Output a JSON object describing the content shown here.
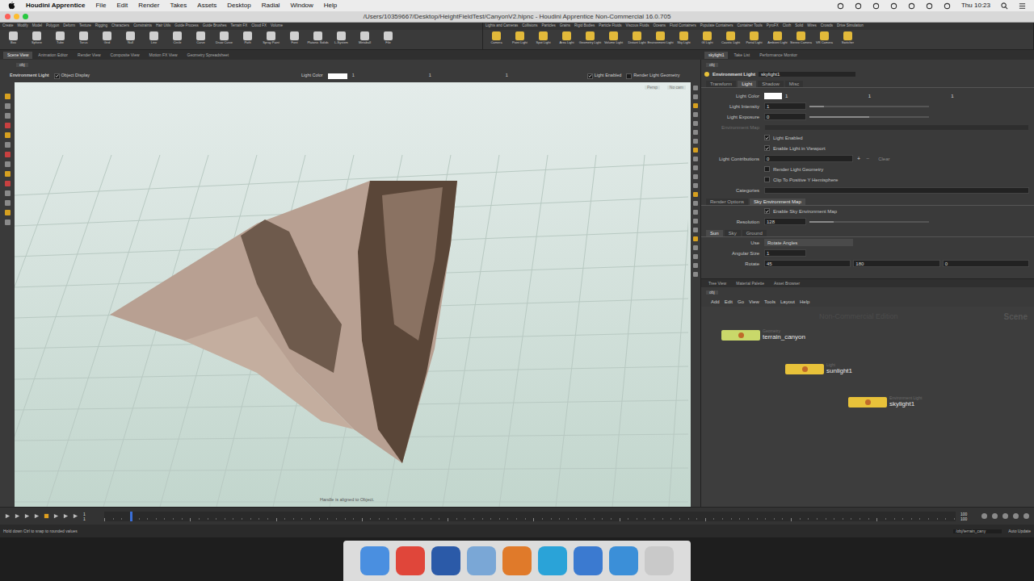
{
  "menubar": {
    "app": "Houdini Apprentice",
    "items": [
      "File",
      "Edit",
      "Render",
      "Takes",
      "Assets",
      "Desktop",
      "Radial",
      "Window",
      "Help"
    ],
    "clock": "Thu 10:23"
  },
  "window": {
    "title": "/Users/10359667/Desktop/HeightFieldTest/CanyonV2.hipnc - Houdini Apprentice Non-Commercial 16.0.705"
  },
  "shelf": {
    "left": {
      "tabs": [
        "Create",
        "Modify",
        "Model",
        "Polygon",
        "Deform",
        "Texture",
        "Rigging",
        "Characters",
        "Constraints",
        "Hair Utils",
        "Guide Process",
        "Guide Brushes",
        "Terrain FX",
        "Cloud FX",
        "Volume"
      ],
      "tools": [
        "Box",
        "Sphere",
        "Tube",
        "Torus",
        "Grid",
        "Null",
        "Line",
        "Circle",
        "Curve",
        "Draw Curve",
        "Path",
        "Spray Paint",
        "Font",
        "Platonic Solids",
        "L-System",
        "Metaball",
        "File"
      ]
    },
    "right": {
      "tabs": [
        "Lights and Cameras",
        "Collisions",
        "Particles",
        "Grains",
        "Rigid Bodies",
        "Particle Fluids",
        "Viscous Fluids",
        "Oceans",
        "Fluid Containers",
        "Populate Containers",
        "Container Tools",
        "PyroFX",
        "Cloth",
        "Solid",
        "Wires",
        "Crowds",
        "Drive Simulation"
      ],
      "tools": [
        "Camera",
        "Point Light",
        "Spot Light",
        "Area Light",
        "Geometry Light",
        "Volume Light",
        "Distant Light",
        "Environment Light",
        "Sky Light",
        "GI Light",
        "Caustic Light",
        "Portal Light",
        "Ambient Light",
        "Stereo Camera",
        "VR Camera",
        "Switcher"
      ]
    }
  },
  "left_pane_tabs": [
    {
      "label": "Scene View",
      "selected": true
    },
    {
      "label": "Animation Editor",
      "selected": false
    },
    {
      "label": "Render View",
      "selected": false
    },
    {
      "label": "Composite View",
      "selected": false
    },
    {
      "label": "Motion FX View",
      "selected": false
    },
    {
      "label": "Geometry Spreadsheet",
      "selected": false
    }
  ],
  "right_pane_tabs": [
    {
      "label": "skylight1",
      "selected": true
    },
    {
      "label": "Take List",
      "selected": false
    },
    {
      "label": "Performance Monitor",
      "selected": false
    }
  ],
  "viewport": {
    "path": "obj",
    "toolbar": {
      "node_type": "Environment Light",
      "object_display": {
        "label": "Object Display",
        "checked": true
      },
      "light_color": {
        "label": "Light Color",
        "values": [
          "1",
          "1",
          "1"
        ]
      },
      "light_enabled": {
        "label": "Light Enabled",
        "checked": true
      },
      "render_light_geometry": {
        "label": "Render Light Geometry",
        "checked": false
      }
    },
    "camera": "Persp",
    "cam": "No cam",
    "hint": "Handle is aligned to Object."
  },
  "params": {
    "path": "obj",
    "node_type": "Environment Light",
    "node_name": "skylight1",
    "tabs": [
      {
        "label": "Transform",
        "selected": false
      },
      {
        "label": "Light",
        "selected": true
      },
      {
        "label": "Shadow",
        "selected": false
      },
      {
        "label": "Misc",
        "selected": false
      }
    ],
    "rows": [
      {
        "kind": "color",
        "label": "Light Color",
        "values": [
          "1",
          "1",
          "1"
        ]
      },
      {
        "kind": "slider",
        "label": "Light Intensity",
        "value": "1",
        "level": 0.12
      },
      {
        "kind": "slider",
        "label": "Light Exposure",
        "value": "0",
        "level": 0.5
      },
      {
        "kind": "field",
        "label": "Environment Map",
        "disabled": true
      },
      {
        "kind": "check",
        "label": "Light Enabled",
        "checked": true
      },
      {
        "kind": "check",
        "label": "Enable Light in Viewport",
        "checked": true
      },
      {
        "kind": "contrib",
        "label": "Light Contributions",
        "value": "0",
        "add": "+",
        "remove": "−",
        "clear": "Clear"
      },
      {
        "kind": "check",
        "label": "Render Light Geometry",
        "checked": false
      },
      {
        "kind": "check",
        "label": "Clip To Positive Y Hemisphere",
        "checked": false
      },
      {
        "kind": "field",
        "label": "Categories",
        "disabled": false
      },
      {
        "kind": "tabs",
        "tabs": [
          {
            "label": "Render Options",
            "selected": false
          },
          {
            "label": "Sky Environment Map",
            "selected": true
          }
        ]
      },
      {
        "kind": "check",
        "label": "Enable Sky Environment Map",
        "checked": true
      },
      {
        "kind": "slider",
        "label": "Resolution",
        "value": "128",
        "level": 0.2
      },
      {
        "kind": "tabs",
        "tabs": [
          {
            "label": "Sun",
            "selected": true
          },
          {
            "label": "Sky",
            "selected": false
          },
          {
            "label": "Ground",
            "selected": false
          }
        ]
      },
      {
        "kind": "menu",
        "label": "Use",
        "value": "Rotate Angles"
      },
      {
        "kind": "number",
        "label": "Angular Size",
        "value": "1"
      },
      {
        "kind": "vector",
        "label": "Rotate",
        "values": [
          "45",
          "180",
          "0"
        ]
      }
    ]
  },
  "network": {
    "tabs": [
      {
        "label": "Tree View",
        "selected": false
      },
      {
        "label": "Material Palette",
        "selected": false
      },
      {
        "label": "Asset Browser",
        "selected": false
      }
    ],
    "path": "obj",
    "menu": [
      "Add",
      "Edit",
      "Go",
      "View",
      "Tools",
      "Layout",
      "Help"
    ],
    "watermark": "Non-Commercial Edition",
    "context": "Scene",
    "nodes": [
      {
        "type": "Geometry",
        "name": "terrain_canyon",
        "color": "#c9d86a"
      },
      {
        "type": "Light",
        "name": "sunlight1",
        "color": "#e8c23a"
      },
      {
        "type": "Environment Light",
        "name": "skylight1",
        "color": "#e8c23a"
      }
    ]
  },
  "timeline": {
    "start": "1",
    "current": "1",
    "end": [
      "100",
      "100"
    ],
    "level": 0.03
  },
  "status_bar": {
    "message": "Hold down Ctrl to snap to rounded values",
    "path": "/obj/terrain_cany",
    "update": "Auto Update"
  },
  "dock": [
    {
      "color": "#4a8fe0"
    },
    {
      "color": "#e0463a"
    },
    {
      "color": "#2b5aa8"
    },
    {
      "color": "#7aa7d6"
    },
    {
      "color": "#e07a2a"
    },
    {
      "color": "#2aa3d8"
    },
    {
      "color": "#3b7ad0"
    },
    {
      "color": "#3b8fd8"
    },
    {
      "color": "#c9c9c9"
    }
  ]
}
